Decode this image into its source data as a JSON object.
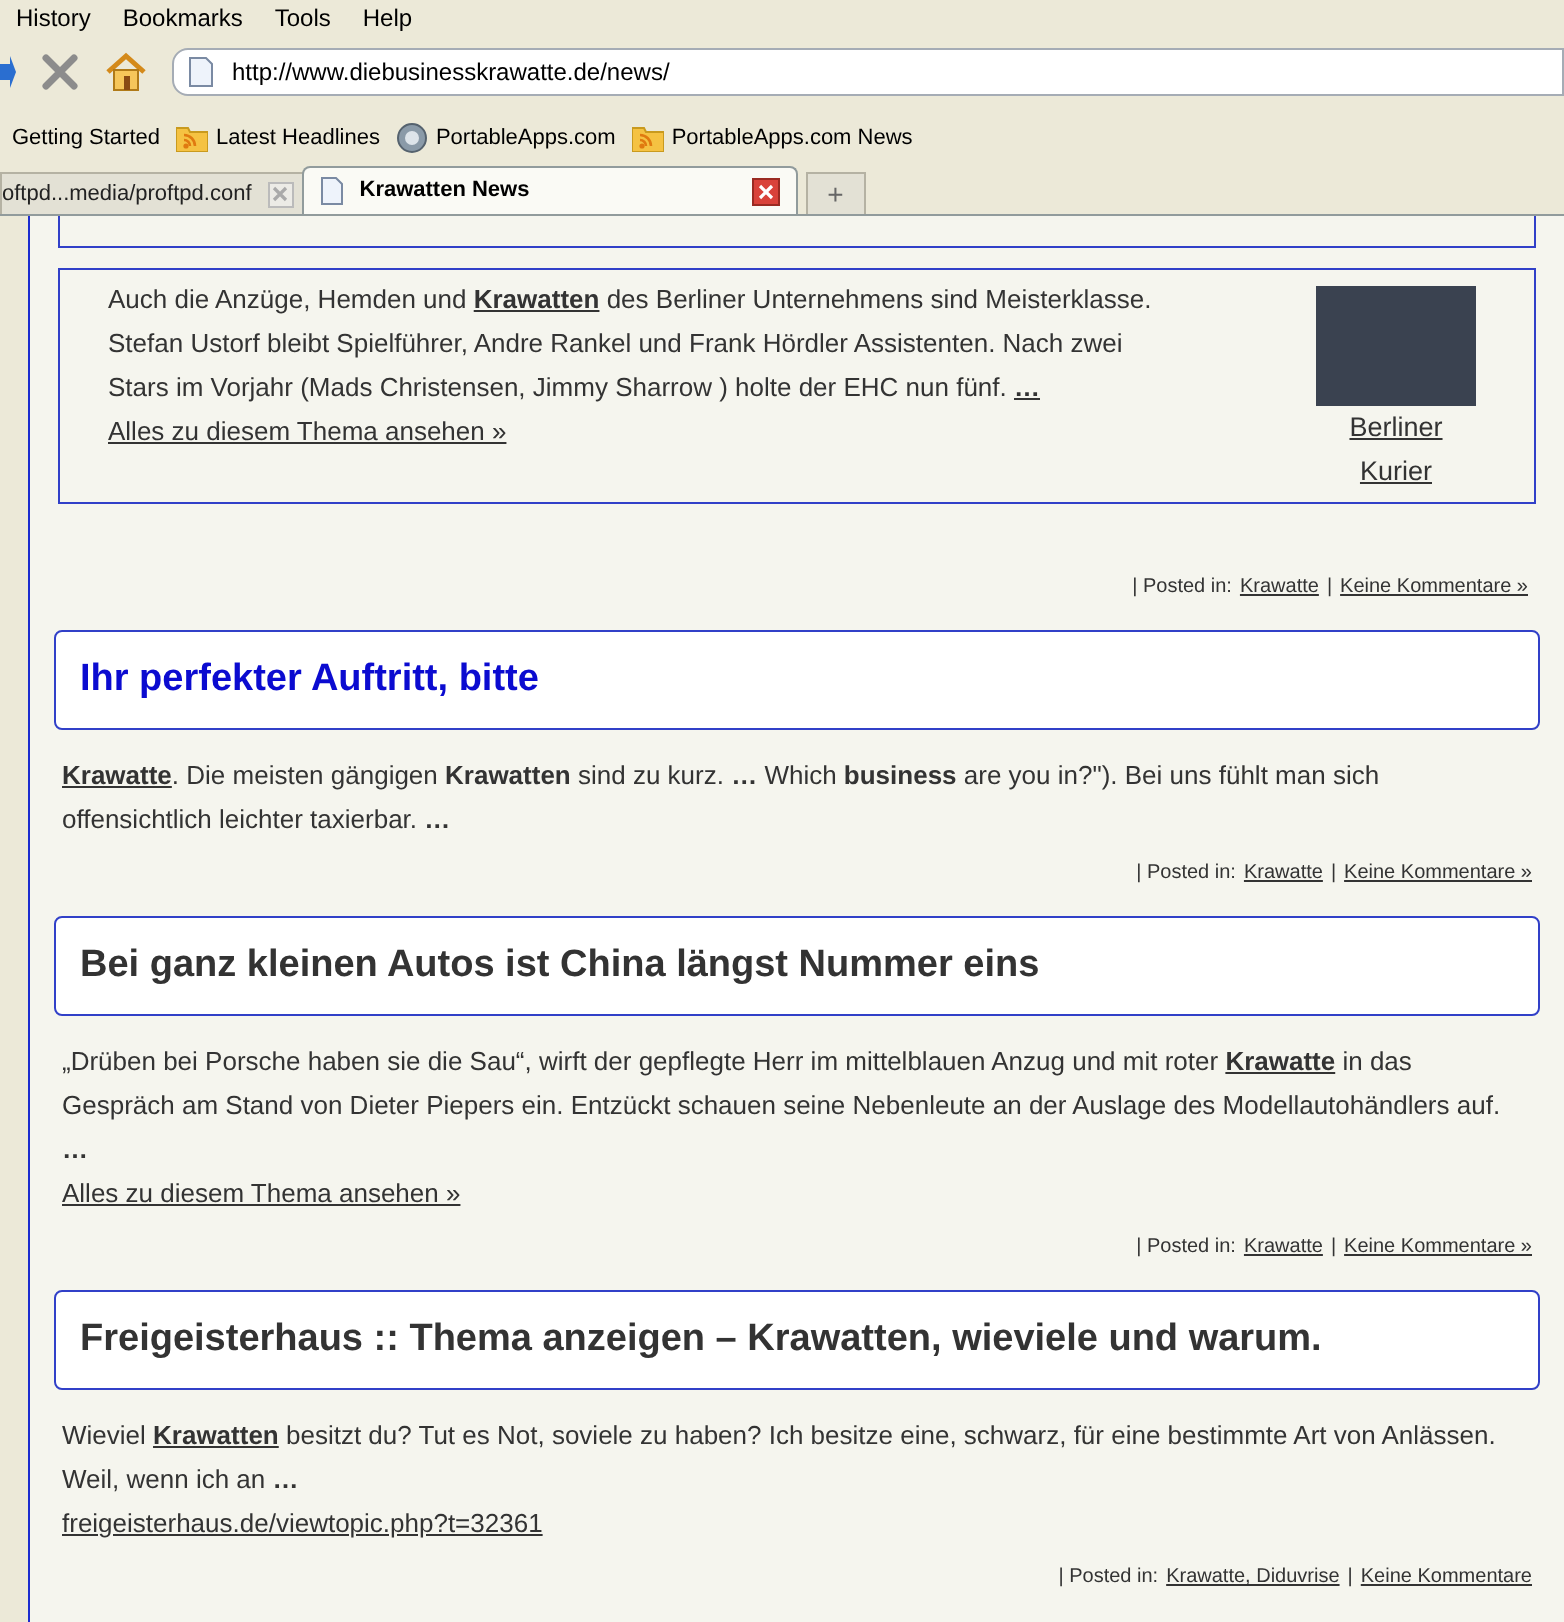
{
  "menu": [
    "History",
    "Bookmarks",
    "Tools",
    "Help"
  ],
  "address": {
    "value": "http://www.diebusinesskrawatte.de/news/"
  },
  "bookmarks": [
    {
      "label": "Getting Started",
      "kind": "page"
    },
    {
      "label": "Latest Headlines",
      "kind": "feed"
    },
    {
      "label": "PortableApps.com",
      "kind": "site"
    },
    {
      "label": "PortableApps.com News",
      "kind": "feed"
    }
  ],
  "tabs": [
    {
      "label": "oftpd...media/proftpd.conf",
      "selected": false
    },
    {
      "label": "Krawatten News",
      "selected": true
    }
  ],
  "new_tab": "+",
  "featured": {
    "text": "Auch die Anzüge, Hemden und **Krawatten** des Berliner Unternehmens sind Meisterklasse. Stefan Ustorf bleibt Spielführer, Andre Rankel und Frank Hördler Assistenten. Nach zwei Stars im Vorjahr (Mads Christensen, Jimmy Sharrow ) holte der EHC nun fünf. **…**",
    "more_link": "Alles zu diesem Thema ansehen »",
    "source": [
      "Berliner",
      "Kurier"
    ],
    "meta": {
      "label": "| Posted in:",
      "category": "Krawatte",
      "separator": "|",
      "comments": "Keine Kommentare »"
    }
  },
  "posts": [
    {
      "title": "Ihr perfekter Auftritt, bitte",
      "kind": "link",
      "text": "**Krawatte**. Die meisten gängigen **Krawatten** sind zu kurz. **…** Which **business** are you in?\"). Bei uns fühlt man sich offensichtlich leichter taxierbar. **…**",
      "meta": {
        "label": "| Posted in:",
        "category": "Krawatte",
        "separator": "|",
        "comments": "Keine Kommentare »"
      }
    },
    {
      "title": "Bei ganz kleinen Autos ist China längst Nummer eins",
      "kind": "plain",
      "text": "„Drüben bei Porsche haben sie die Sau“, wirft der gepflegte Herr im mittelblauen Anzug und mit roter **Krawatte** in das Gespräch am Stand von Dieter Piepers ein. Entzückt schauen seine Nebenleute an der Auslage des Modellautohändlers auf. **…**",
      "link": "Alles zu diesem Thema ansehen »",
      "meta": {
        "label": "| Posted in:",
        "category": "Krawatte",
        "separator": "|",
        "comments": "Keine Kommentare »"
      }
    },
    {
      "title": "Freigeisterhaus :: Thema anzeigen – Krawatten, wieviele und warum.",
      "kind": "plain",
      "text": "Wieviel **Krawatten** besitzt du? Tut es Not, soviele zu haben? Ich besitze eine, schwarz, für eine bestimmte Art von Anlässen. Weil, wenn ich an **…**",
      "link": "freigeisterhaus.de/viewtopic.php?t=32361",
      "meta": {
        "label": "| Posted in:",
        "category": "Krawatte, Diduvrise",
        "separator": "|",
        "comments": "Keine Kommentare"
      }
    }
  ]
}
